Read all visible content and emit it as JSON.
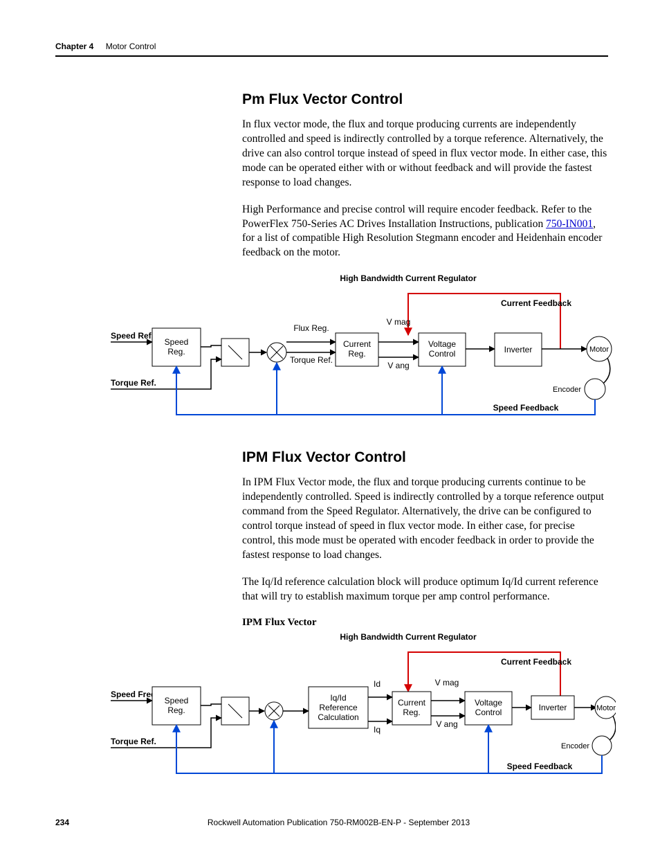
{
  "header": {
    "chapter": "Chapter 4",
    "section": "Motor Control"
  },
  "sec1": {
    "title": "Pm Flux Vector Control",
    "p1": "In flux vector mode, the flux and torque producing currents are independently controlled and speed is indirectly controlled by a torque reference. Alternatively, the drive can also control torque instead of speed in flux vector mode. In either case, this mode can be operated either with or without feedback and will provide the fastest response to load changes.",
    "p2a": "High Performance and precise control will require encoder feedback. Refer to the PowerFlex 750-Series AC Drives Installation Instructions, publication ",
    "p2_link": "750-IN001",
    "p2b": ", for a list of compatible High Resolution Stegmann encoder and Heidenhain encoder feedback on the motor."
  },
  "diag1": {
    "top": "High Bandwidth Current Regulator",
    "cur_fb": "Current Feedback",
    "speed_ref": "Speed Ref.",
    "torque_ref": "Torque Ref.",
    "speed_reg_l1": "Speed",
    "speed_reg_l2": "Reg.",
    "flux_reg": "Flux Reg.",
    "torque_ref2": "Torque Ref.",
    "cur_reg_l1": "Current",
    "cur_reg_l2": "Reg.",
    "vmag": "V mag",
    "vang": "V ang",
    "volt_ctrl_l1": "Voltage",
    "volt_ctrl_l2": "Control",
    "inverter": "Inverter",
    "motor": "Motor",
    "encoder": "Encoder",
    "speed_fb": "Speed Feedback"
  },
  "sec2": {
    "title": "IPM Flux Vector Control",
    "p1": "In IPM Flux Vector mode, the flux and torque producing currents continue to be independently controlled. Speed is indirectly controlled by a torque reference output command from the Speed Regulator. Alternatively, the drive can be configured to control torque instead of speed in flux vector mode. In either case, for precise control, this mode must be operated with encoder feedback in order to provide the fastest response to load changes.",
    "p2": "The Iq/Id reference calculation block will produce optimum Iq/Id current reference that will try to establish maximum torque per amp control performance."
  },
  "caption2": "IPM Flux Vector",
  "diag2": {
    "top": "High Bandwidth Current Regulator",
    "cur_fb": "Current Feedback",
    "speed_freq": "Speed Freq.",
    "torque_ref": "Torque Ref.",
    "speed_reg_l1": "Speed",
    "speed_reg_l2": "Reg.",
    "ref_l1": "Iq/Id",
    "ref_l2": "Reference",
    "ref_l3": "Calculation",
    "id": "Id",
    "iq": "Iq",
    "cur_reg_l1": "Current",
    "cur_reg_l2": "Reg.",
    "vmag": "V mag",
    "vang": "V ang",
    "volt_ctrl_l1": "Voltage",
    "volt_ctrl_l2": "Control",
    "inverter": "Inverter",
    "motor": "Motor",
    "encoder": "Encoder",
    "speed_fb": "Speed Feedback"
  },
  "footer": {
    "page": "234",
    "pub": "Rockwell Automation Publication 750-RM002B-EN-P - September 2013"
  }
}
